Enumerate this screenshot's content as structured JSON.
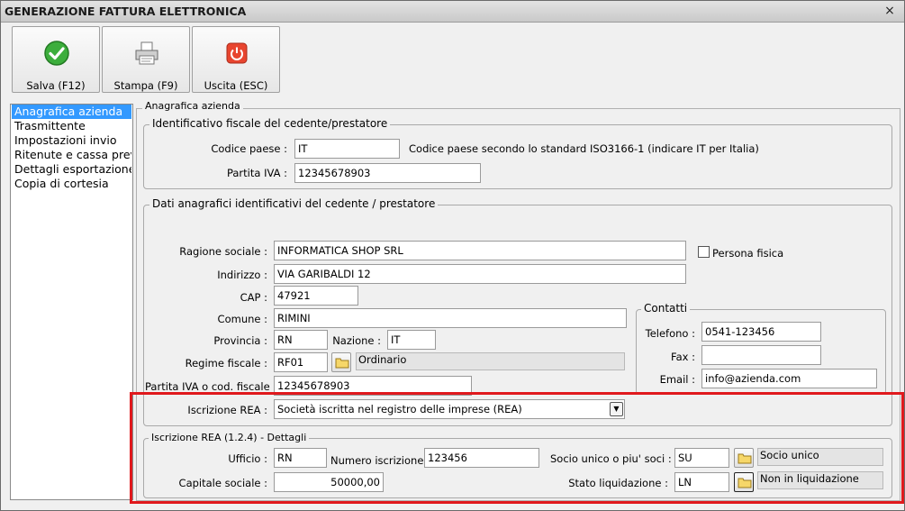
{
  "window": {
    "title": "GENERAZIONE FATTURA ELETTRONICA",
    "close_glyph": "×"
  },
  "toolbar": {
    "save_label": "Salva (F12)",
    "print_label": "Stampa (F9)",
    "exit_label": "Uscita (ESC)"
  },
  "nav": {
    "items": [
      "Anagrafica azienda",
      "Trasmittente",
      "Impostazioni invio",
      "Ritenute e cassa previdenziale",
      "Dettagli esportazione",
      "Copia di cortesia"
    ]
  },
  "panel": {
    "title": "Anagrafica azienda"
  },
  "fiscal": {
    "title": "Identificativo fiscale del cedente/prestatore",
    "country_label": "Codice paese :",
    "country_value": "IT",
    "country_hint": "Codice paese secondo lo standard ISO3166-1 (indicare IT per Italia)",
    "vat_label": "Partita IVA :",
    "vat_value": "12345678903"
  },
  "registry": {
    "title": "Dati anagrafici identificativi del cedente / prestatore",
    "company_label": "Ragione sociale :",
    "company_value": "INFORMATICA SHOP SRL",
    "natural_person_label": "Persona fisica",
    "address_label": "Indirizzo :",
    "address_value": "VIA GARIBALDI 12",
    "zip_label": "CAP :",
    "zip_value": "47921",
    "city_label": "Comune :",
    "city_value": "RIMINI",
    "province_label": "Provincia :",
    "province_value": "RN",
    "nation_label": "Nazione :",
    "nation_value": "IT",
    "tax_regime_label": "Regime fiscale :",
    "tax_regime_code": "RF01",
    "tax_regime_desc": "Ordinario",
    "vat_or_cf_label": "Partita IVA o cod. fiscale :",
    "vat_or_cf_value": "12345678903",
    "rea_label": "Iscrizione REA :",
    "rea_value": "Società iscritta nel registro delle imprese (REA)"
  },
  "contacts": {
    "title": "Contatti",
    "phone_label": "Telefono :",
    "phone_value": "0541-123456",
    "fax_label": "Fax :",
    "fax_value": "",
    "email_label": "Email :",
    "email_value": "info@azienda.com"
  },
  "rea_details": {
    "title": "Iscrizione REA (1.2.4) - Dettagli",
    "office_label": "Ufficio :",
    "office_value": "RN",
    "number_label": "Numero iscrizione :",
    "number_value": "123456",
    "partner_label": "Socio unico o piu' soci :",
    "partner_code": "SU",
    "partner_desc": "Socio unico",
    "capital_label": "Capitale sociale :",
    "capital_value": "50000,00",
    "liquidation_label": "Stato liquidazione :",
    "liquidation_code": "LN",
    "liquidation_desc": "Non in liquidazione"
  },
  "colors": {
    "highlight_frame": "#e0191d",
    "selection": "#3399ff"
  }
}
